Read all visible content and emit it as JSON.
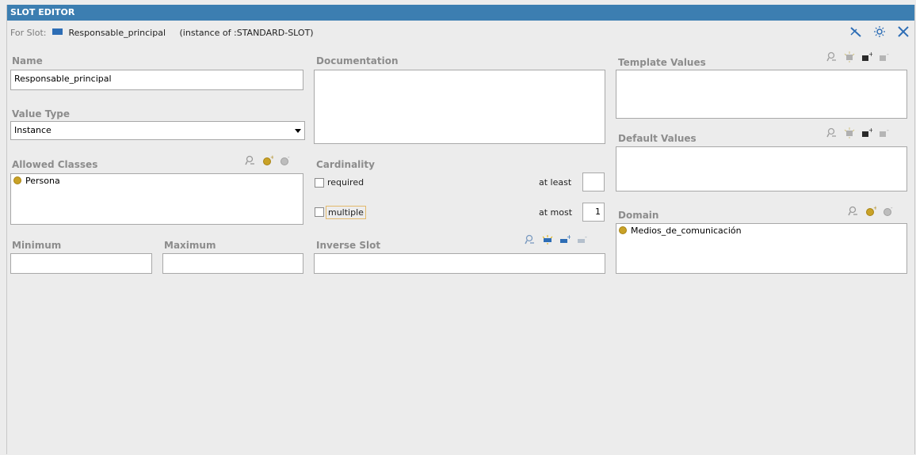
{
  "title": "SLOT EDITOR",
  "for_slot": {
    "label": "For Slot:",
    "slot_name": "Responsable_principal",
    "instance_of": "(instance of :STANDARD-SLOT)"
  },
  "name": {
    "label": "Name",
    "value": "Responsable_principal"
  },
  "value_type": {
    "label": "Value Type",
    "selected": "Instance"
  },
  "allowed_classes": {
    "label": "Allowed Classes",
    "items": [
      "Persona"
    ]
  },
  "minimum": {
    "label": "Minimum",
    "value": ""
  },
  "maximum": {
    "label": "Maximum",
    "value": ""
  },
  "documentation": {
    "label": "Documentation",
    "value": ""
  },
  "cardinality": {
    "label": "Cardinality",
    "required_label": "required",
    "multiple_label": "multiple",
    "at_least_label": "at least",
    "at_least_value": "",
    "at_most_label": "at most",
    "at_most_value": "1",
    "required_checked": false,
    "multiple_checked": false
  },
  "inverse_slot": {
    "label": "Inverse Slot",
    "value": ""
  },
  "template_values": {
    "label": "Template Values"
  },
  "default_values": {
    "label": "Default Values"
  },
  "domain": {
    "label": "Domain",
    "items": [
      "Medios_de_comunicación"
    ]
  },
  "colors": {
    "titlebar": "#3c7eb1",
    "class_dot": "#c9a227",
    "slot_icon": "#2d6db5"
  },
  "icons": {
    "top": [
      "hide-icon",
      "configure-icon",
      "close-icon"
    ],
    "list_tools": [
      "view-icon",
      "create-icon",
      "add-icon",
      "remove-icon"
    ]
  }
}
